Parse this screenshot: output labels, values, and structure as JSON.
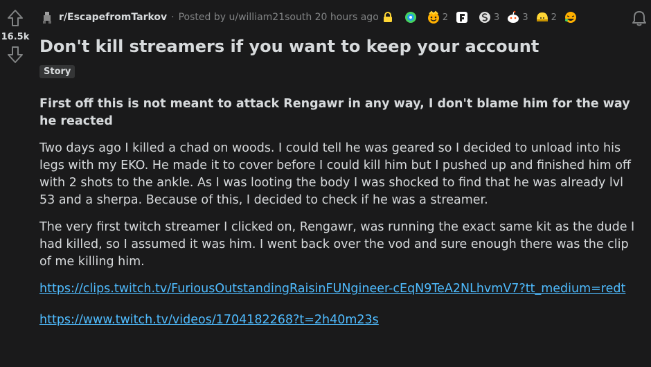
{
  "vote": {
    "score": "16.5k"
  },
  "meta": {
    "subreddit": "r/EscapefromTarkov",
    "separator": "·",
    "posted_by": "Posted by u/william21south 20 hours ago",
    "awards": [
      {
        "icon": "globe-award-icon",
        "count": ""
      },
      {
        "icon": "wholesome-award-icon",
        "count": "2"
      },
      {
        "icon": "f-award-icon",
        "count": ""
      },
      {
        "icon": "silver-award-icon",
        "count": "3"
      },
      {
        "icon": "snoo-award-icon",
        "count": "3"
      },
      {
        "icon": "helmet-award-icon",
        "count": "2"
      },
      {
        "icon": "laugh-award-icon",
        "count": ""
      }
    ]
  },
  "post": {
    "title": "Don't kill streamers if you want to keep your account",
    "flair": "Story",
    "para1": "First off this is not meant to attack Rengawr in any way, I don't blame him for the way he reacted",
    "para2": "Two days ago I killed a chad on woods. I could tell he was geared so I decided to unload into his legs with my EKO. He made it to cover before I could kill him but I pushed up and finished him off with 2 shots to the ankle. As I was looting the body I was shocked to find that he was already lvl 53 and a sherpa. Because of this, I decided to check if he was a streamer.",
    "para3": "The very first twitch streamer I clicked on, Rengawr, was running the exact same kit as the dude I had killed, so I assumed it was him. I went back over the vod and sure enough there was the clip of me killing him.",
    "link1": "https://clips.twitch.tv/FuriousOutstandingRaisinFUNgineer-cEqN9TeA2NLhvmV7?tt_medium=redt",
    "link2": "https://www.twitch.tv/videos/1704182268?t=2h40m23s"
  },
  "colors": {
    "background": "#1a1a1b",
    "text": "#d7dadc",
    "muted": "#818384",
    "link": "#4fbcff",
    "lock": "#ffd635"
  }
}
